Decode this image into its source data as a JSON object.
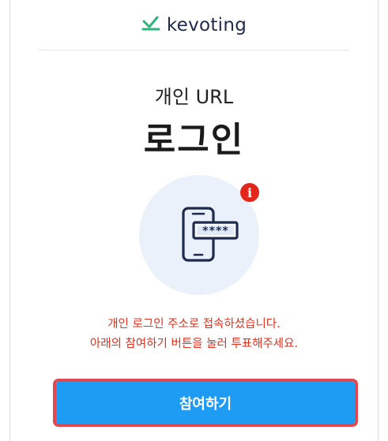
{
  "header": {
    "logo_text": "kevoting",
    "logo_icon": "kevoting-logo-icon"
  },
  "login": {
    "subtitle": "개인 URL",
    "title": "로그인"
  },
  "illustration": {
    "phone_icon": "phone-password-icon",
    "password_mask": "****",
    "badge_icon": "info-badge-icon",
    "badge_text": "i"
  },
  "message": {
    "line1": "개인 로그인 주소로 접속하셨습니다.",
    "line2": "아래의 참여하기 버튼을 눌러 투표해주세요."
  },
  "actions": {
    "join_label": "참여하기"
  },
  "colors": {
    "brand_green": "#2fb37a",
    "brand_navy": "#1f2b4d",
    "button_blue": "#1e9cf4",
    "highlight_red": "#e5474f",
    "message_red": "#e0321f"
  }
}
